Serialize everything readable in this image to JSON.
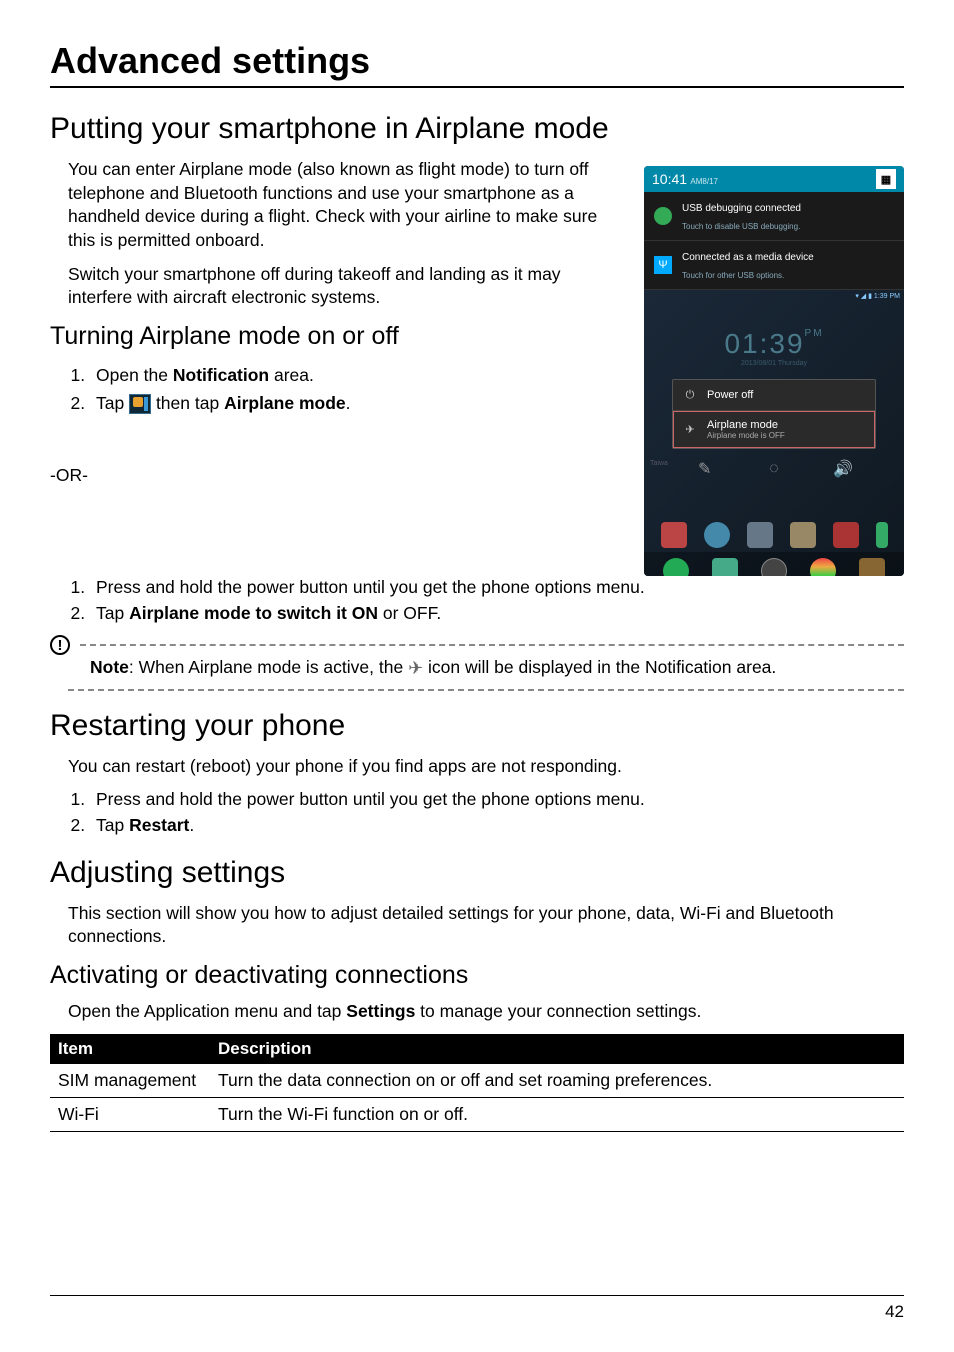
{
  "h1": "Advanced settings",
  "section_airplane": {
    "title": "Putting your smartphone in Airplane mode",
    "p1": "You can enter Airplane mode (also known as flight mode) to turn off telephone and Bluetooth functions and use your smartphone as a handheld device during a flight. Check with your airline to make sure this is permitted onboard.",
    "p2": "Switch your smartphone off during takeoff and landing as it may interfere with aircraft electronic systems.",
    "sub_title": "Turning Airplane mode on or off",
    "step1_a": "Open the ",
    "step1_b_bold": "Notification",
    "step1_c": " area.",
    "step2_a": "Tap ",
    "step2_b": " then tap ",
    "step2_c_bold": "Airplane mode",
    "step2_d": ".",
    "or_text": "-OR-",
    "alt_step1": "Press and hold the power button until you get the phone options menu.",
    "alt_step2_a": "Tap ",
    "alt_step2_b_bold": "Airplane mode to switch it ON",
    "alt_step2_c": " or OFF.",
    "note_a_bold": "Note",
    "note_b": ": When Airplane mode is active, the ",
    "note_c": " icon will be displayed in the Notification area."
  },
  "phone": {
    "time_top": "10:41",
    "time_top_suffix": "AM8/17",
    "notif1_title": "USB debugging connected",
    "notif1_sub": "Touch to disable USB debugging.",
    "notif2_title": "Connected as a media device",
    "notif2_sub": "Touch for other USB options.",
    "mini_status": "▾ ◢ ▮ 1:39 PM",
    "clock": "01:39",
    "clock_pm": "PM",
    "clock_sub": "2013/08/01 Thursday",
    "popup_poweroff": "Power off",
    "popup_airplane": "Airplane mode",
    "popup_airplane_sub": "Airplane mode is OFF",
    "taiwan": "Taiwa"
  },
  "section_restart": {
    "title": "Restarting your phone",
    "p1": "You can restart (reboot) your phone if you find apps are not responding.",
    "step1": "Press and hold the power button until you get the phone options menu.",
    "step2_a": "Tap ",
    "step2_b_bold": "Restart",
    "step2_c": "."
  },
  "section_adjust": {
    "title": "Adjusting settings",
    "p1": "This section will show you how to adjust detailed settings for your phone, data, Wi-Fi and Bluetooth connections.",
    "sub_title": "Activating or deactivating connections",
    "p2_a": "Open the Application menu and tap ",
    "p2_b_bold": "Settings",
    "p2_c": " to manage your connection settings.",
    "table": {
      "header_item": "Item",
      "header_desc": "Description",
      "rows": [
        {
          "item": "SIM management",
          "desc": "Turn the data connection on or off and set roaming preferences."
        },
        {
          "item": "Wi-Fi",
          "desc": "Turn the Wi-Fi function on or off."
        }
      ]
    }
  },
  "page_number": "42"
}
